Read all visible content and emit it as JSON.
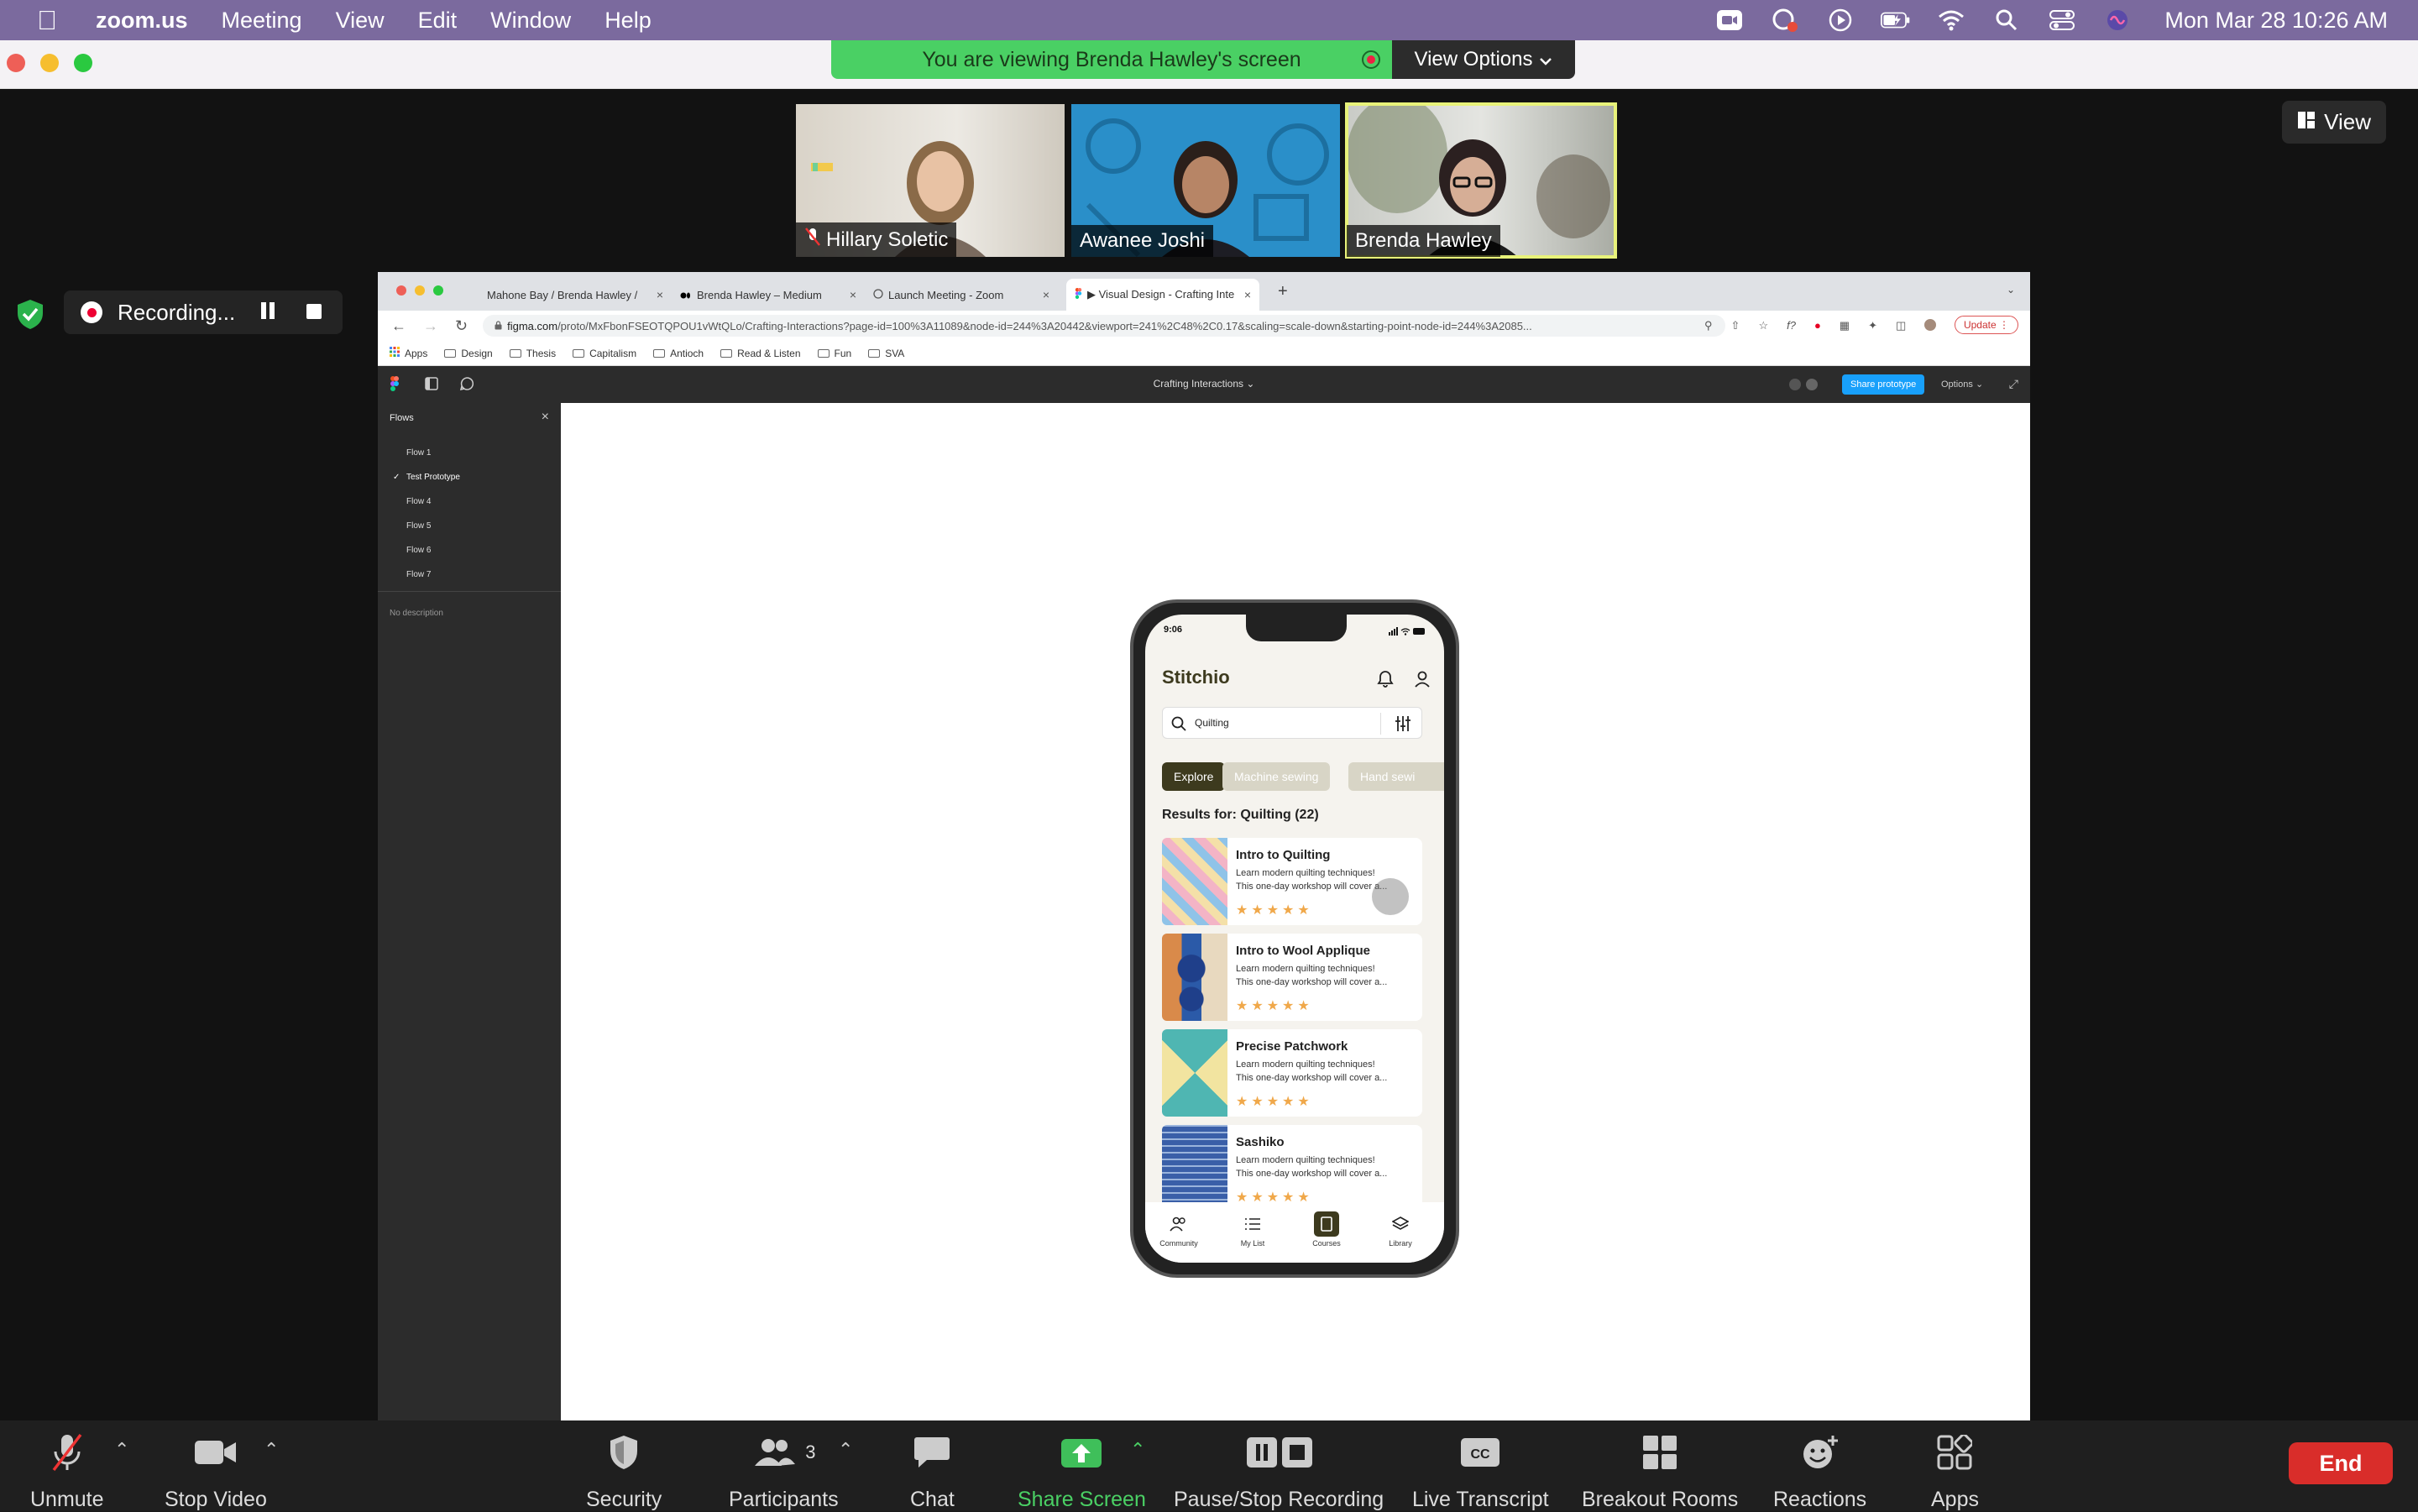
{
  "menubar": {
    "app_name": "zoom.us",
    "items": [
      "Meeting",
      "View",
      "Edit",
      "Window",
      "Help"
    ],
    "clock": "Mon Mar 28  10:26 AM"
  },
  "banner": {
    "message": "You are viewing Brenda Hawley's screen",
    "view_options": "View Options"
  },
  "participants": [
    {
      "name": "Hillary Soletic",
      "muted": true
    },
    {
      "name": "Awanee Joshi",
      "muted": false
    },
    {
      "name": "Brenda Hawley",
      "muted": false,
      "active": true
    }
  ],
  "view_button": "View",
  "recording": {
    "label": "Recording..."
  },
  "browser": {
    "tabs": [
      {
        "title": "Mahone Bay / Brenda Hawley /"
      },
      {
        "title": "Brenda Hawley – Medium"
      },
      {
        "title": "Launch Meeting - Zoom"
      },
      {
        "title": "▶ Visual Design - Crafting Inte"
      }
    ],
    "url_host": "figma.com",
    "url_path": "/proto/MxFbonFSEOTQPOU1vWtQLo/Crafting-Interactions?page-id=100%3A11089&node-id=244%3A20442&viewport=241%2C48%2C0.17&scaling=scale-down&starting-point-node-id=244%3A2085...",
    "update_label": "Update",
    "bookmarks": [
      "Apps",
      "Design",
      "Thesis",
      "Capitalism",
      "Antioch",
      "Read & Listen",
      "Fun",
      "SVA"
    ]
  },
  "figma": {
    "file_title": "Crafting Interactions",
    "share_label": "Share prototype",
    "options_label": "Options",
    "flows_header": "Flows",
    "flows": [
      "Flow 1",
      "Test Prototype",
      "Flow 4",
      "Flow 5",
      "Flow 6",
      "Flow 7"
    ],
    "selected_flow": "Test Prototype",
    "description": "No description"
  },
  "app": {
    "time": "9:06",
    "brand": "Stitchio",
    "search_value": "Quilting",
    "chips": [
      "Explore",
      "Machine sewing",
      "Hand sewi"
    ],
    "results_title": "Results for: Quilting (22)",
    "courses": [
      {
        "title": "Intro to Quilting",
        "desc1": "Learn modern quilting techniques!",
        "desc2": "This one-day workshop will cover a...",
        "rating": 5
      },
      {
        "title": "Intro to Wool Applique",
        "desc1": "Learn modern quilting techniques!",
        "desc2": "This one-day workshop will cover a...",
        "rating": 5
      },
      {
        "title": "Precise Patchwork",
        "desc1": "Learn modern quilting techniques!",
        "desc2": "This one-day workshop will cover a...",
        "rating": 5
      },
      {
        "title": "Sashiko",
        "desc1": "Learn modern quilting techniques!",
        "desc2": "This one-day workshop will cover a...",
        "rating": 5
      }
    ],
    "tabbar": [
      "Community",
      "My List",
      "Courses",
      "Library"
    ],
    "active_tab": "Courses"
  },
  "toolbar": {
    "unmute": "Unmute",
    "stop_video": "Stop Video",
    "security": "Security",
    "participants": "Participants",
    "participants_count": "3",
    "chat": "Chat",
    "share_screen": "Share Screen",
    "pause_stop_recording": "Pause/Stop Recording",
    "live_transcript": "Live Transcript",
    "breakout_rooms": "Breakout Rooms",
    "reactions": "Reactions",
    "apps": "Apps",
    "end": "End"
  },
  "colors": {
    "share_green": "#4ad064",
    "end_red": "#d92d2a",
    "app_dark": "#3d3a1e",
    "star": "#f0a84a"
  }
}
